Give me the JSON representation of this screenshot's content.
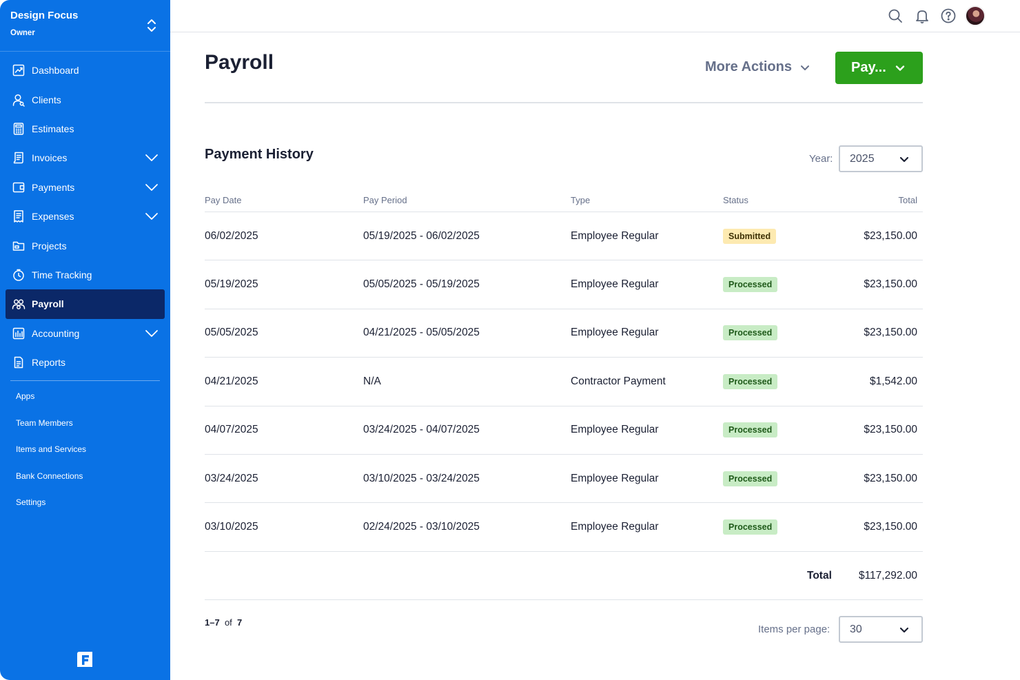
{
  "business": {
    "name": "Design Focus",
    "role": "Owner"
  },
  "nav": [
    {
      "label": "Dashboard",
      "icon": "dashboard-icon",
      "expandable": false
    },
    {
      "label": "Clients",
      "icon": "clients-icon",
      "expandable": false
    },
    {
      "label": "Estimates",
      "icon": "estimates-icon",
      "expandable": false
    },
    {
      "label": "Invoices",
      "icon": "invoices-icon",
      "expandable": true
    },
    {
      "label": "Payments",
      "icon": "payments-icon",
      "expandable": true
    },
    {
      "label": "Expenses",
      "icon": "expenses-icon",
      "expandable": true
    },
    {
      "label": "Projects",
      "icon": "projects-icon",
      "expandable": false
    },
    {
      "label": "Time Tracking",
      "icon": "time-tracking-icon",
      "expandable": false
    },
    {
      "label": "Payroll",
      "icon": "payroll-icon",
      "expandable": false,
      "active": true
    },
    {
      "label": "Accounting",
      "icon": "accounting-icon",
      "expandable": true
    },
    {
      "label": "Reports",
      "icon": "reports-icon",
      "expandable": false
    }
  ],
  "sub_nav": [
    "Apps",
    "Team Members",
    "Items and Services",
    "Bank Connections",
    "Settings"
  ],
  "topbar": {
    "icons": [
      "search-icon",
      "bell-icon",
      "help-icon"
    ]
  },
  "page": {
    "title": "Payroll",
    "more_actions": "More Actions",
    "pay_button": "Pay..."
  },
  "history": {
    "title": "Payment History",
    "year_label": "Year:",
    "year": "2025",
    "columns": [
      "Pay Date",
      "Pay Period",
      "Type",
      "Status",
      "Total"
    ],
    "rows": [
      {
        "date": "06/02/2025",
        "period": "05/19/2025 - 06/02/2025",
        "type": "Employee Regular",
        "status": "Submitted",
        "total": "$23,150.00"
      },
      {
        "date": "05/19/2025",
        "period": "05/05/2025 - 05/19/2025",
        "type": "Employee Regular",
        "status": "Processed",
        "total": "$23,150.00"
      },
      {
        "date": "05/05/2025",
        "period": "04/21/2025 - 05/05/2025",
        "type": "Employee Regular",
        "status": "Processed",
        "total": "$23,150.00"
      },
      {
        "date": "04/21/2025",
        "period": "N/A",
        "type": "Contractor Payment",
        "status": "Processed",
        "total": "$1,542.00"
      },
      {
        "date": "04/07/2025",
        "period": "03/24/2025 - 04/07/2025",
        "type": "Employee Regular",
        "status": "Processed",
        "total": "$23,150.00"
      },
      {
        "date": "03/24/2025",
        "period": "03/10/2025 - 03/24/2025",
        "type": "Employee Regular",
        "status": "Processed",
        "total": "$23,150.00"
      },
      {
        "date": "03/10/2025",
        "period": "02/24/2025 - 03/10/2025",
        "type": "Employee Regular",
        "status": "Processed",
        "total": "$23,150.00"
      }
    ],
    "total_label": "Total",
    "total_value": "$117,292.00"
  },
  "pagination": {
    "range": "1–7",
    "of": "of",
    "count": "7",
    "items_per_page_label": "Items per page:",
    "items_per_page": "30"
  },
  "colors": {
    "sidebar": "#0a72e5",
    "sidebar_active": "#0b2868",
    "pay_button": "#2ca01c",
    "processed_badge": "#c8ecc5",
    "submitted_badge": "#fdeab1"
  }
}
